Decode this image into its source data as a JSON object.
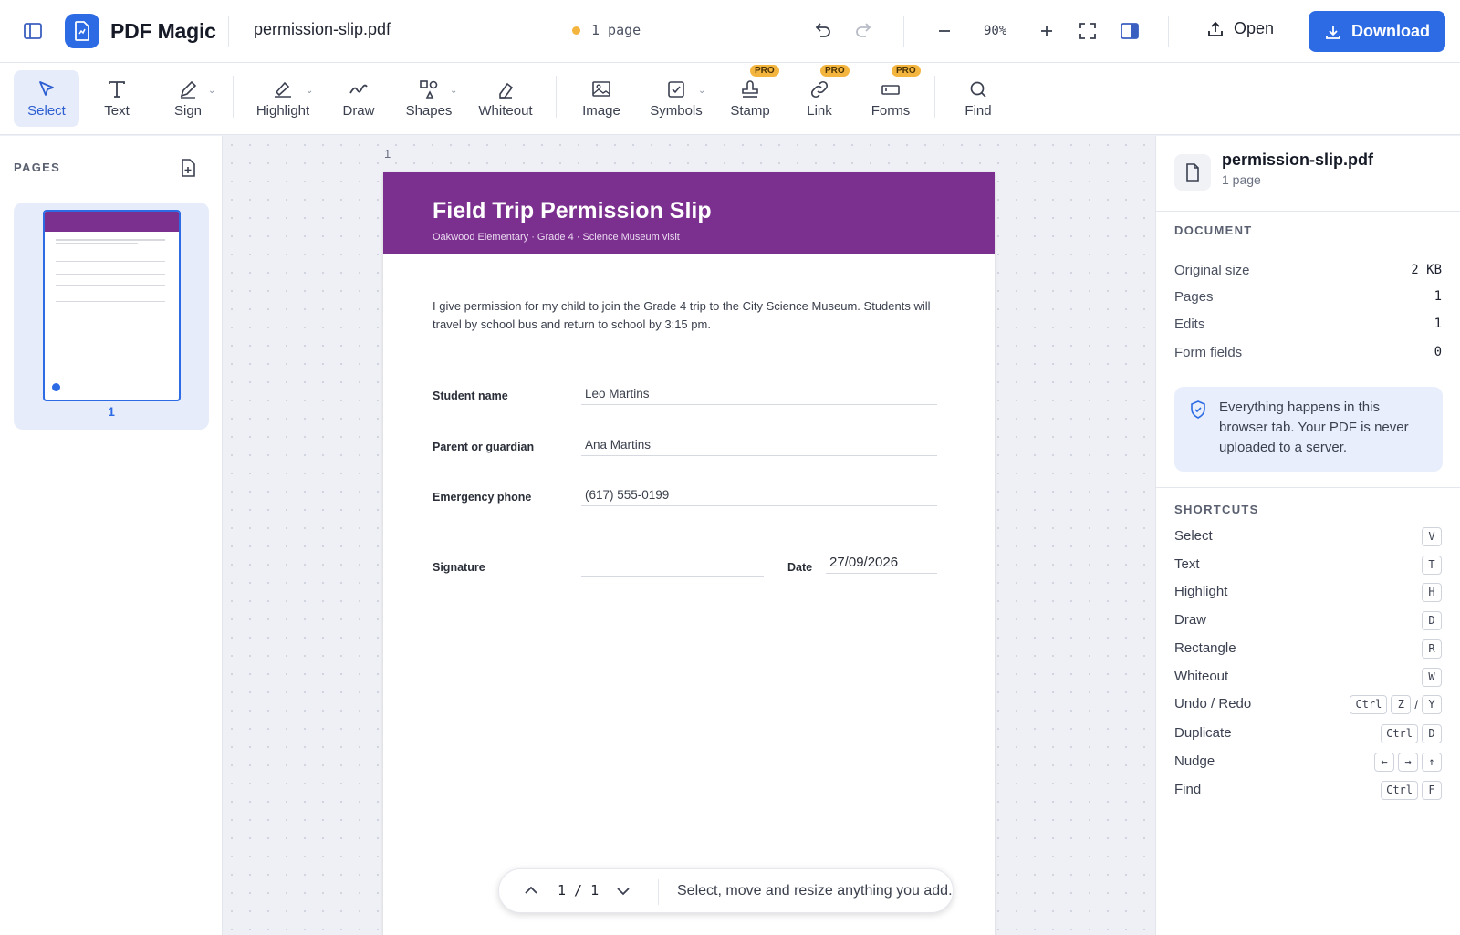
{
  "app": {
    "name": "PDF Magic",
    "filename": "permission-slip.pdf",
    "page_count_label": "1 page"
  },
  "topbar": {
    "zoom": "90%",
    "open_label": "Open",
    "download_label": "Download"
  },
  "toolbar": {
    "tools": [
      {
        "label": "Select",
        "active": true
      },
      {
        "label": "Text"
      },
      {
        "label": "Sign"
      },
      {
        "label": "Highlight"
      },
      {
        "label": "Draw"
      },
      {
        "label": "Shapes"
      },
      {
        "label": "Whiteout"
      },
      {
        "label": "Image"
      },
      {
        "label": "Symbols"
      },
      {
        "label": "Stamp",
        "badge": "PRO"
      },
      {
        "label": "Link",
        "badge": "PRO"
      },
      {
        "label": "Forms",
        "badge": "PRO"
      },
      {
        "label": "Find"
      }
    ]
  },
  "sidebar": {
    "title": "PAGES",
    "thumb_number": "1"
  },
  "canvas": {
    "page_index": "1",
    "document": {
      "title": "Field Trip Permission Slip",
      "subtitle": "Oakwood Elementary  ·  Grade 4  ·  Science Museum visit",
      "body": "I give permission for my child to join the Grade 4 trip to the City Science Museum. Students will travel by school bus and return to school by 3:15 pm.",
      "fields": [
        {
          "label": "Student name",
          "value": "Leo Martins"
        },
        {
          "label": "Parent or guardian",
          "value": "Ana Martins"
        },
        {
          "label": "Emergency phone",
          "value": "(617) 555-0199"
        }
      ],
      "signature_label": "Signature",
      "date_label": "Date",
      "date_value": "27/09/2026"
    },
    "pager": {
      "current": "1 / 1",
      "hint": "Select, move and resize anything you add."
    }
  },
  "right_panel": {
    "filename": "permission-slip.pdf",
    "pages_label": "1 page",
    "document_title": "DOCUMENT",
    "stats": [
      {
        "key": "Original size",
        "value": "2 KB"
      },
      {
        "key": "Pages",
        "value": "1"
      },
      {
        "key": "Edits",
        "value": "1"
      },
      {
        "key": "Form fields",
        "value": "0"
      }
    ],
    "privacy": "Everything happens in this browser tab. Your PDF is never uploaded to a server.",
    "shortcuts_title": "SHORTCUTS",
    "shortcuts": [
      {
        "label": "Select",
        "keys": [
          "V"
        ]
      },
      {
        "label": "Text",
        "keys": [
          "T"
        ]
      },
      {
        "label": "Highlight",
        "keys": [
          "H"
        ]
      },
      {
        "label": "Draw",
        "keys": [
          "D"
        ]
      },
      {
        "label": "Rectangle",
        "keys": [
          "R"
        ]
      },
      {
        "label": "Whiteout",
        "keys": [
          "W"
        ]
      },
      {
        "label": "Undo / Redo",
        "keys": [
          "Ctrl",
          "Z",
          "/",
          "Y"
        ]
      },
      {
        "label": "Duplicate",
        "keys": [
          "Ctrl",
          "D"
        ]
      },
      {
        "label": "Nudge",
        "keys": [
          "←",
          "→",
          "↑"
        ]
      },
      {
        "label": "Find",
        "keys": [
          "Ctrl",
          "F"
        ]
      }
    ]
  }
}
